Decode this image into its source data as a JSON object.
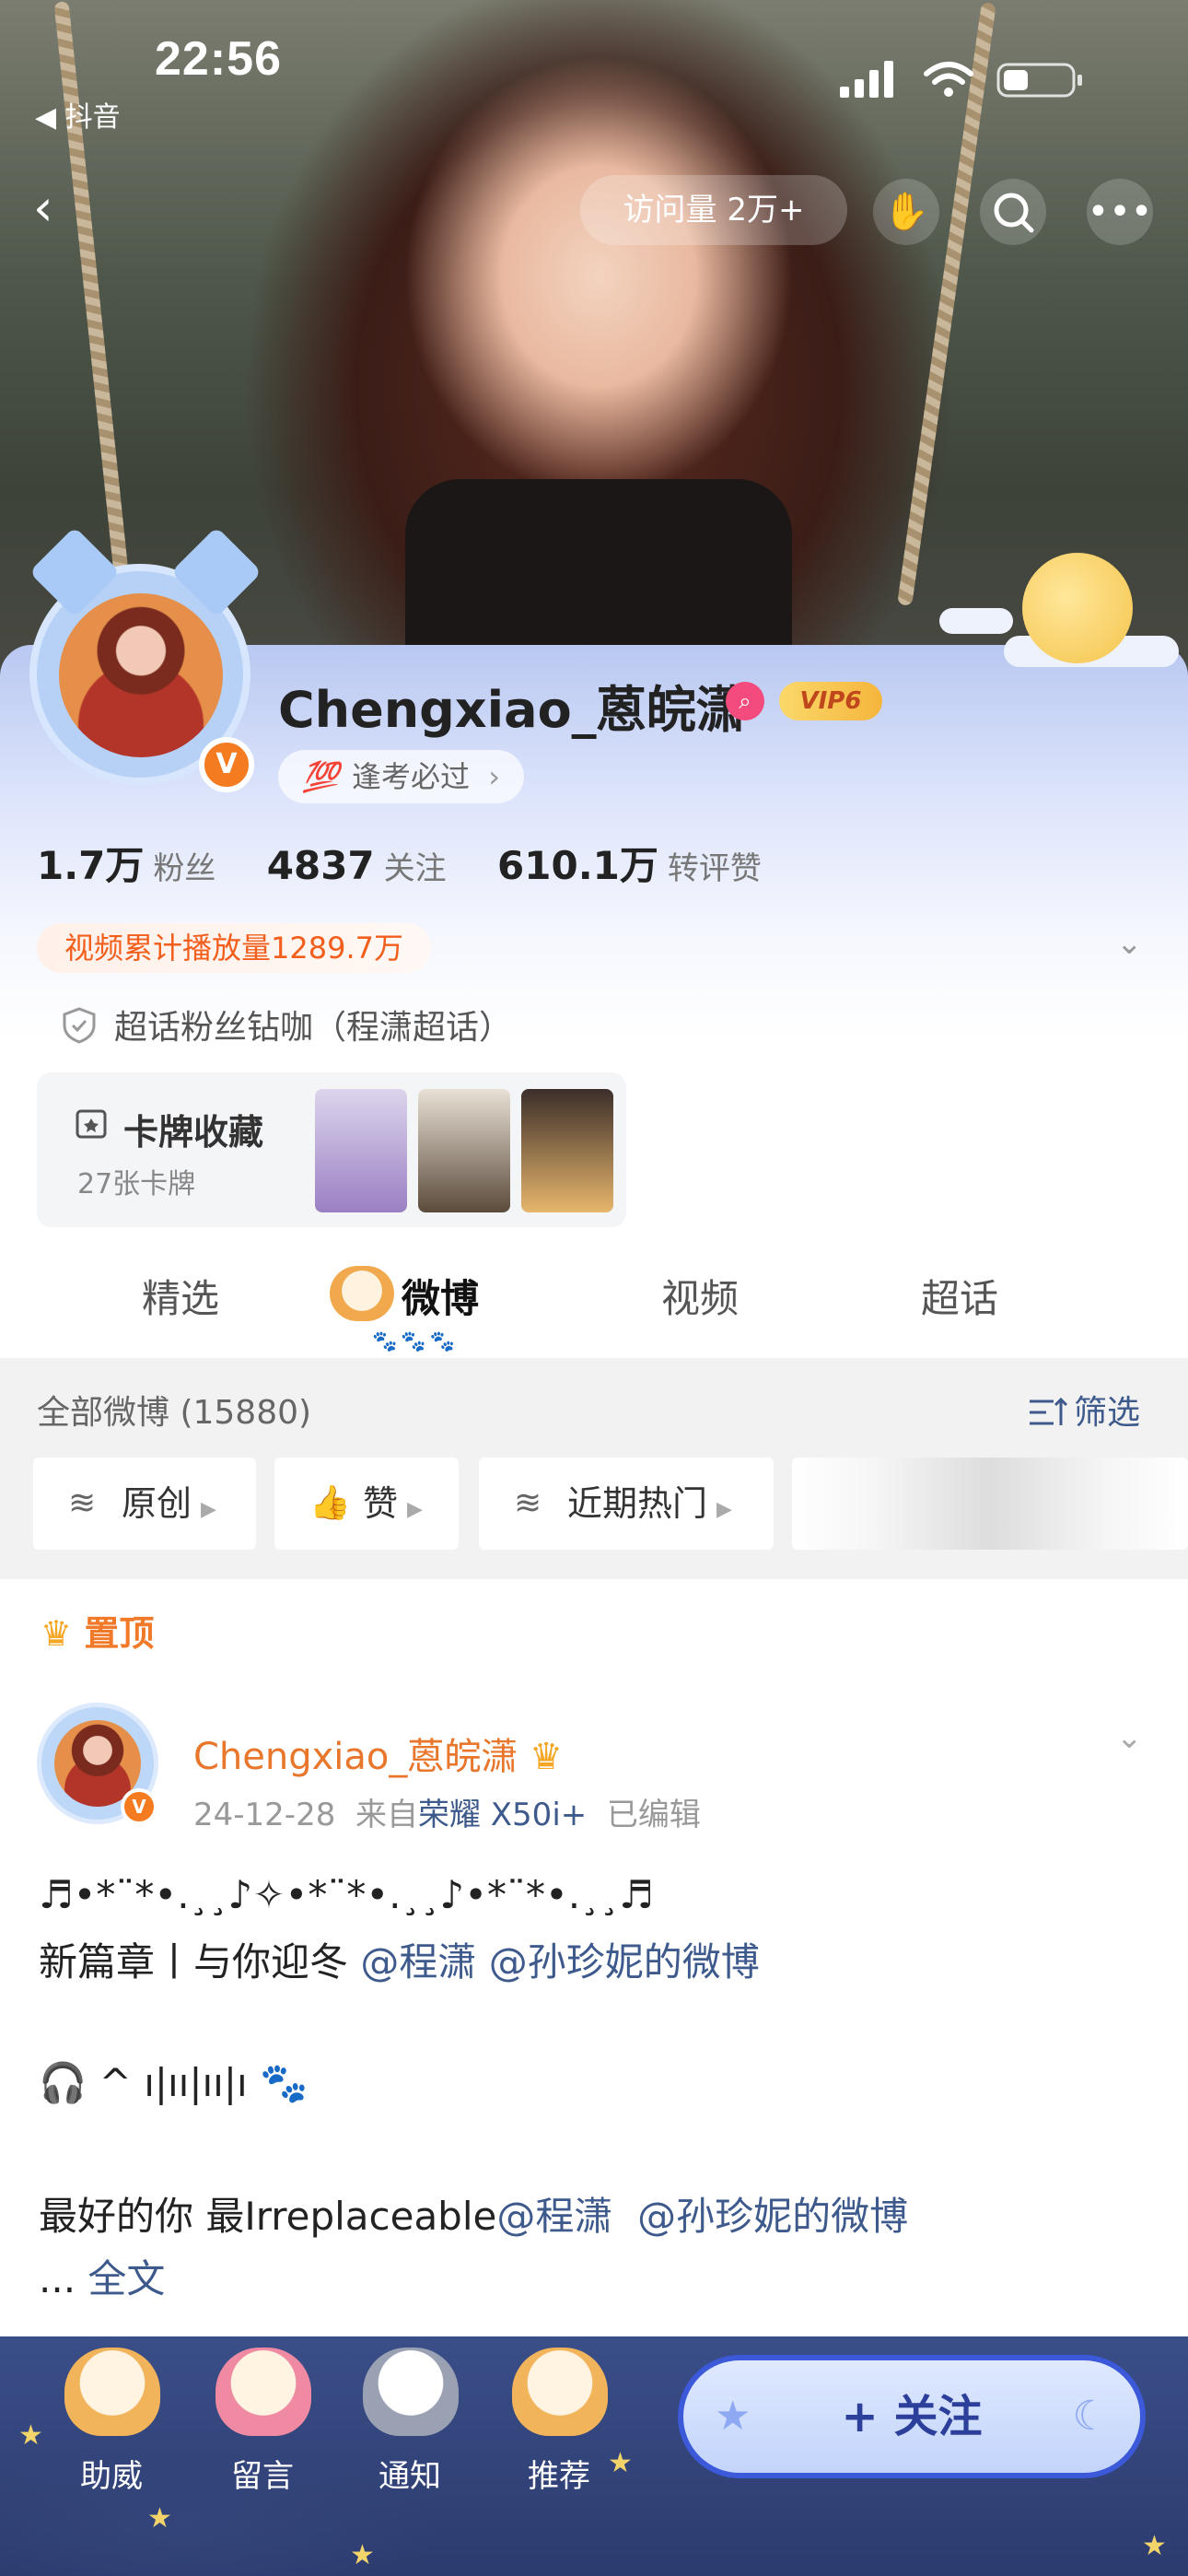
{
  "status": {
    "time": "22:56",
    "back_app": "抖音"
  },
  "nav": {
    "visits": "访问量 2万+"
  },
  "profile": {
    "username": "Chengxiao_蒽皖潇",
    "vip": "VIP6",
    "tag": "逢考必过",
    "stats": [
      {
        "num": "1.7万",
        "label": "粉丝"
      },
      {
        "num": "4837",
        "label": "关注"
      },
      {
        "num": "610.1万",
        "label": "转评赞"
      }
    ],
    "play_count": "视频累计播放量1289.7万",
    "super_topic": "超话粉丝钻咖（程潇超话）",
    "cards": {
      "title": "卡牌收藏",
      "sub": "27张卡牌"
    }
  },
  "tabs": [
    "精选",
    "微博",
    "视频",
    "超话"
  ],
  "filter": {
    "count": "全部微博 (15880)",
    "screen": "筛选",
    "chips": [
      "原创",
      "赞",
      "近期热门"
    ]
  },
  "post": {
    "pinned": "置顶",
    "author": "Chengxiao_蒽皖潇",
    "date": "24-12-28",
    "from_prefix": "来自",
    "device": "荣耀 X50i+",
    "edited": "已编辑",
    "line1": "♬•*¨*•.¸¸♪✧•*¨*•.¸¸♪•*¨*•.¸¸♬",
    "line2_text": "新篇章丨与你迎冬",
    "line2_mention1": "@程潇",
    "line2_mention2": "@孙珍妮的微博",
    "line3": "🎧 ^ ı|ıı|ıı|ı 🐾",
    "line4_text": "最好的你 最Irreplaceable",
    "line4_mention1": "@程潇",
    "line4_mention2": "@孙珍妮的微博",
    "more_prefix": "...",
    "more_link": "全文"
  },
  "bottom": {
    "items": [
      "助威",
      "留言",
      "通知",
      "推荐"
    ],
    "follow": "+ 关注"
  }
}
